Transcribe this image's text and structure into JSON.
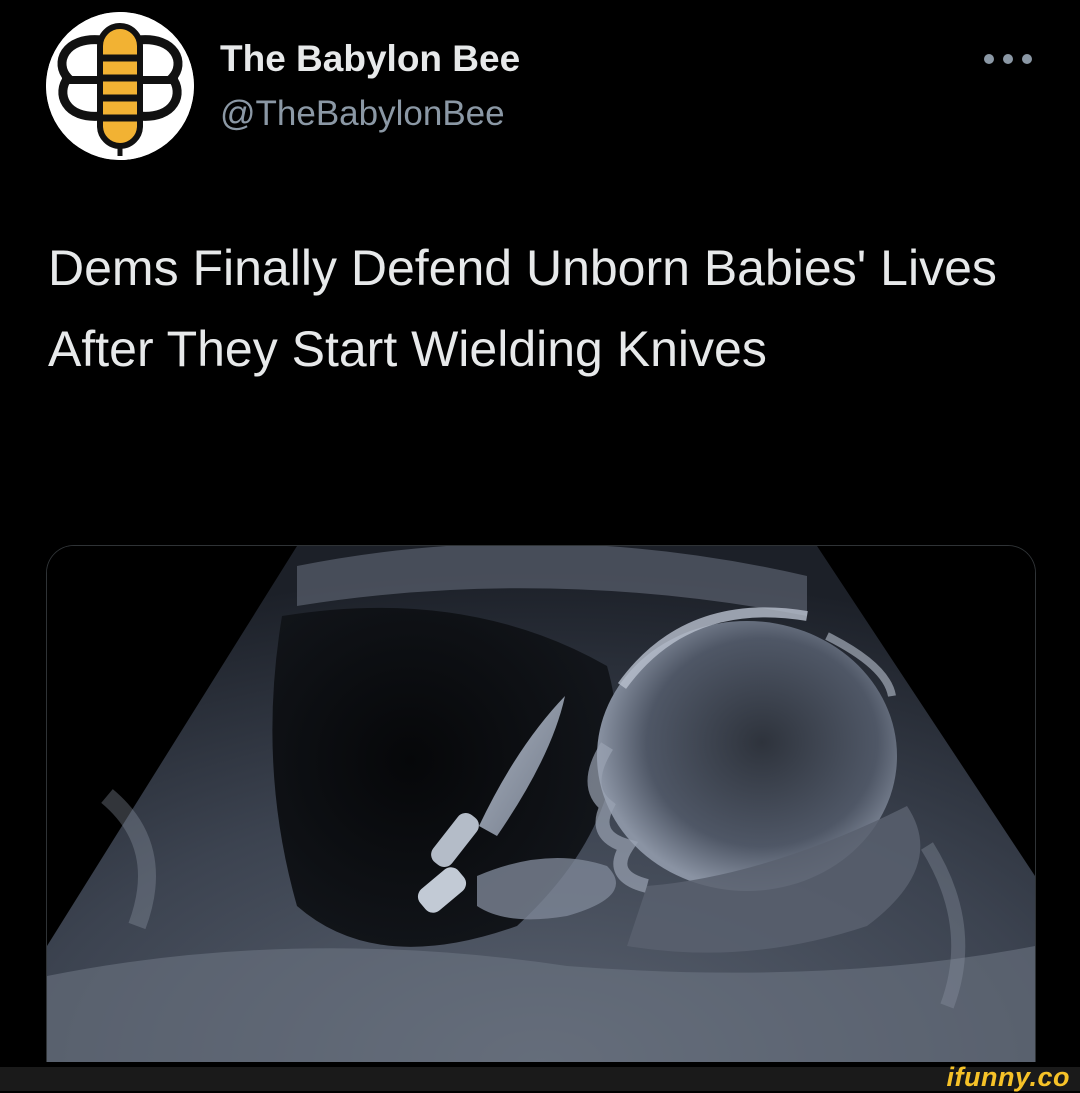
{
  "account": {
    "display_name": "The Babylon Bee",
    "handle": "@TheBabylonBee",
    "avatar_icon": "bee-logo-icon"
  },
  "tweet": {
    "text": "Dems Finally Defend Unborn Babies' Lives After They Start Wielding Knives",
    "more_icon": "more-options-icon"
  },
  "media": {
    "type": "ultrasound-image"
  },
  "watermark": {
    "text": "ifunny.co"
  },
  "colors": {
    "background": "#000000",
    "primary_text": "#e7e9ea",
    "secondary_text": "#8b98a5",
    "bee_yellow": "#f2b233",
    "watermark_yellow": "#f6c228"
  }
}
